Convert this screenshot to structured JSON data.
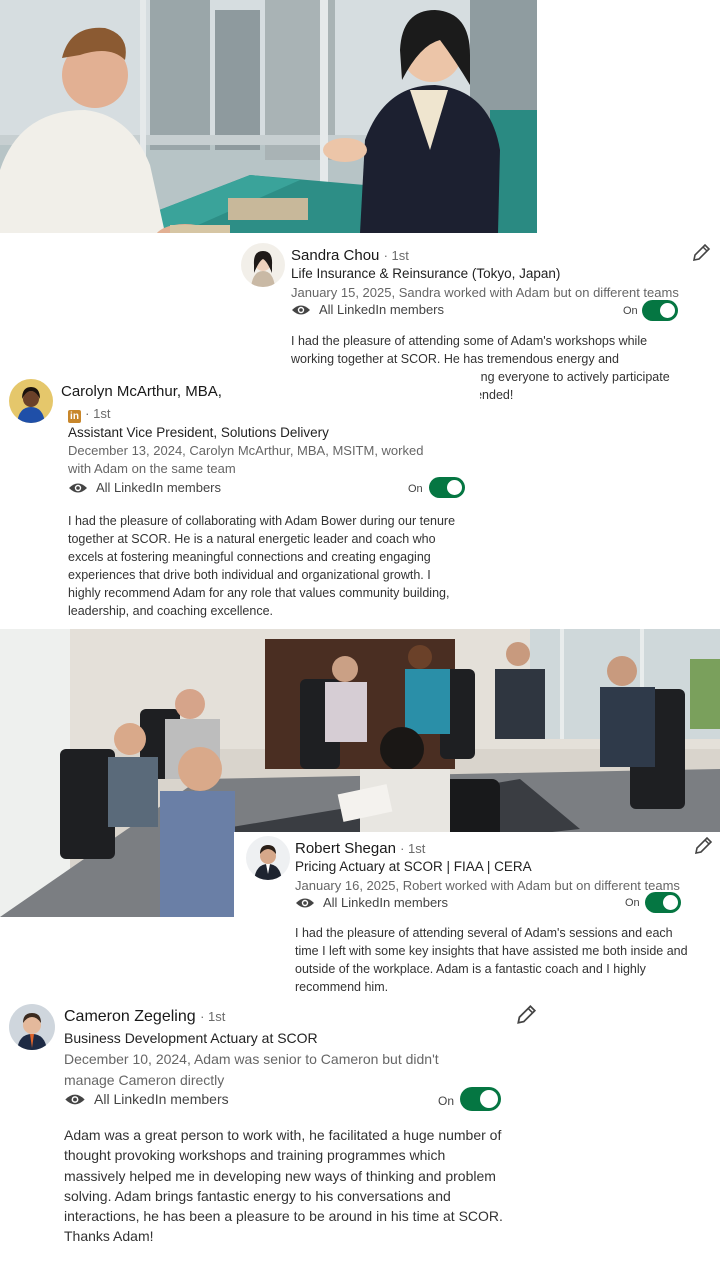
{
  "cards": [
    {
      "name": "Sandra Chou",
      "degree": "· 1st",
      "headline": "Life Insurance & Reinsurance (Tokyo, Japan)",
      "relationship": "January 15, 2025, Sandra worked with Adam but on different teams",
      "visibility": "All LinkedIn members",
      "toggle_label": "On",
      "text": "I had the pleasure of attending some of Adam's workshops while working together at SCOR. He has tremendous energy and enthusiasm as well as skill in leading everyone to actively participate in the workshops. Highly recommended!"
    },
    {
      "name": "Carolyn McArthur, MBA,",
      "degree": "· 1st",
      "badge": "in",
      "headline": "Assistant Vice President, Solutions Delivery",
      "relationship": "December 13, 2024, Carolyn McArthur, MBA, MSITM, worked with Adam on the same team",
      "visibility": "All LinkedIn members",
      "toggle_label": "On",
      "text": "I had the pleasure of collaborating with Adam Bower during our tenure together at SCOR. He is a natural energetic leader and coach who excels at fostering meaningful connections and creating engaging experiences that drive both individual and organizational growth. I highly recommend Adam for any role that values community building, leadership, and coaching excellence."
    },
    {
      "name": "Robert Shegan",
      "degree": "· 1st",
      "headline": "Pricing Actuary at SCOR | FIAA | CERA",
      "relationship": "January 16, 2025, Robert worked with Adam but on different teams",
      "visibility": "All LinkedIn members",
      "toggle_label": "On",
      "text": "I had the pleasure of attending several of Adam's sessions and each time I left with some key insights that have assisted me both inside and outside of the workplace. Adam is a fantastic coach and I highly recommend him."
    },
    {
      "name": "Cameron Zegeling",
      "degree": "· 1st",
      "headline": "Business Development Actuary at SCOR",
      "relationship": "December 10, 2024, Adam was senior to Cameron but didn't manage Cameron directly",
      "visibility": "All LinkedIn members",
      "toggle_label": "On",
      "text": "Adam was a great person to work with, he facilitated a huge number of thought provoking workshops and training programmes which massively helped me in developing new ways of thinking and problem solving. Adam brings fantastic energy to his conversations and interactions, he has been a pleasure to be around in his time at SCOR. Thanks Adam!"
    }
  ],
  "icons": {
    "visibility": "eye-icon",
    "edit": "pencil-icon",
    "linkedin": "linkedin-badge-icon"
  },
  "colors": {
    "toggle_on": "#057642",
    "secondary_text": "#666666"
  }
}
